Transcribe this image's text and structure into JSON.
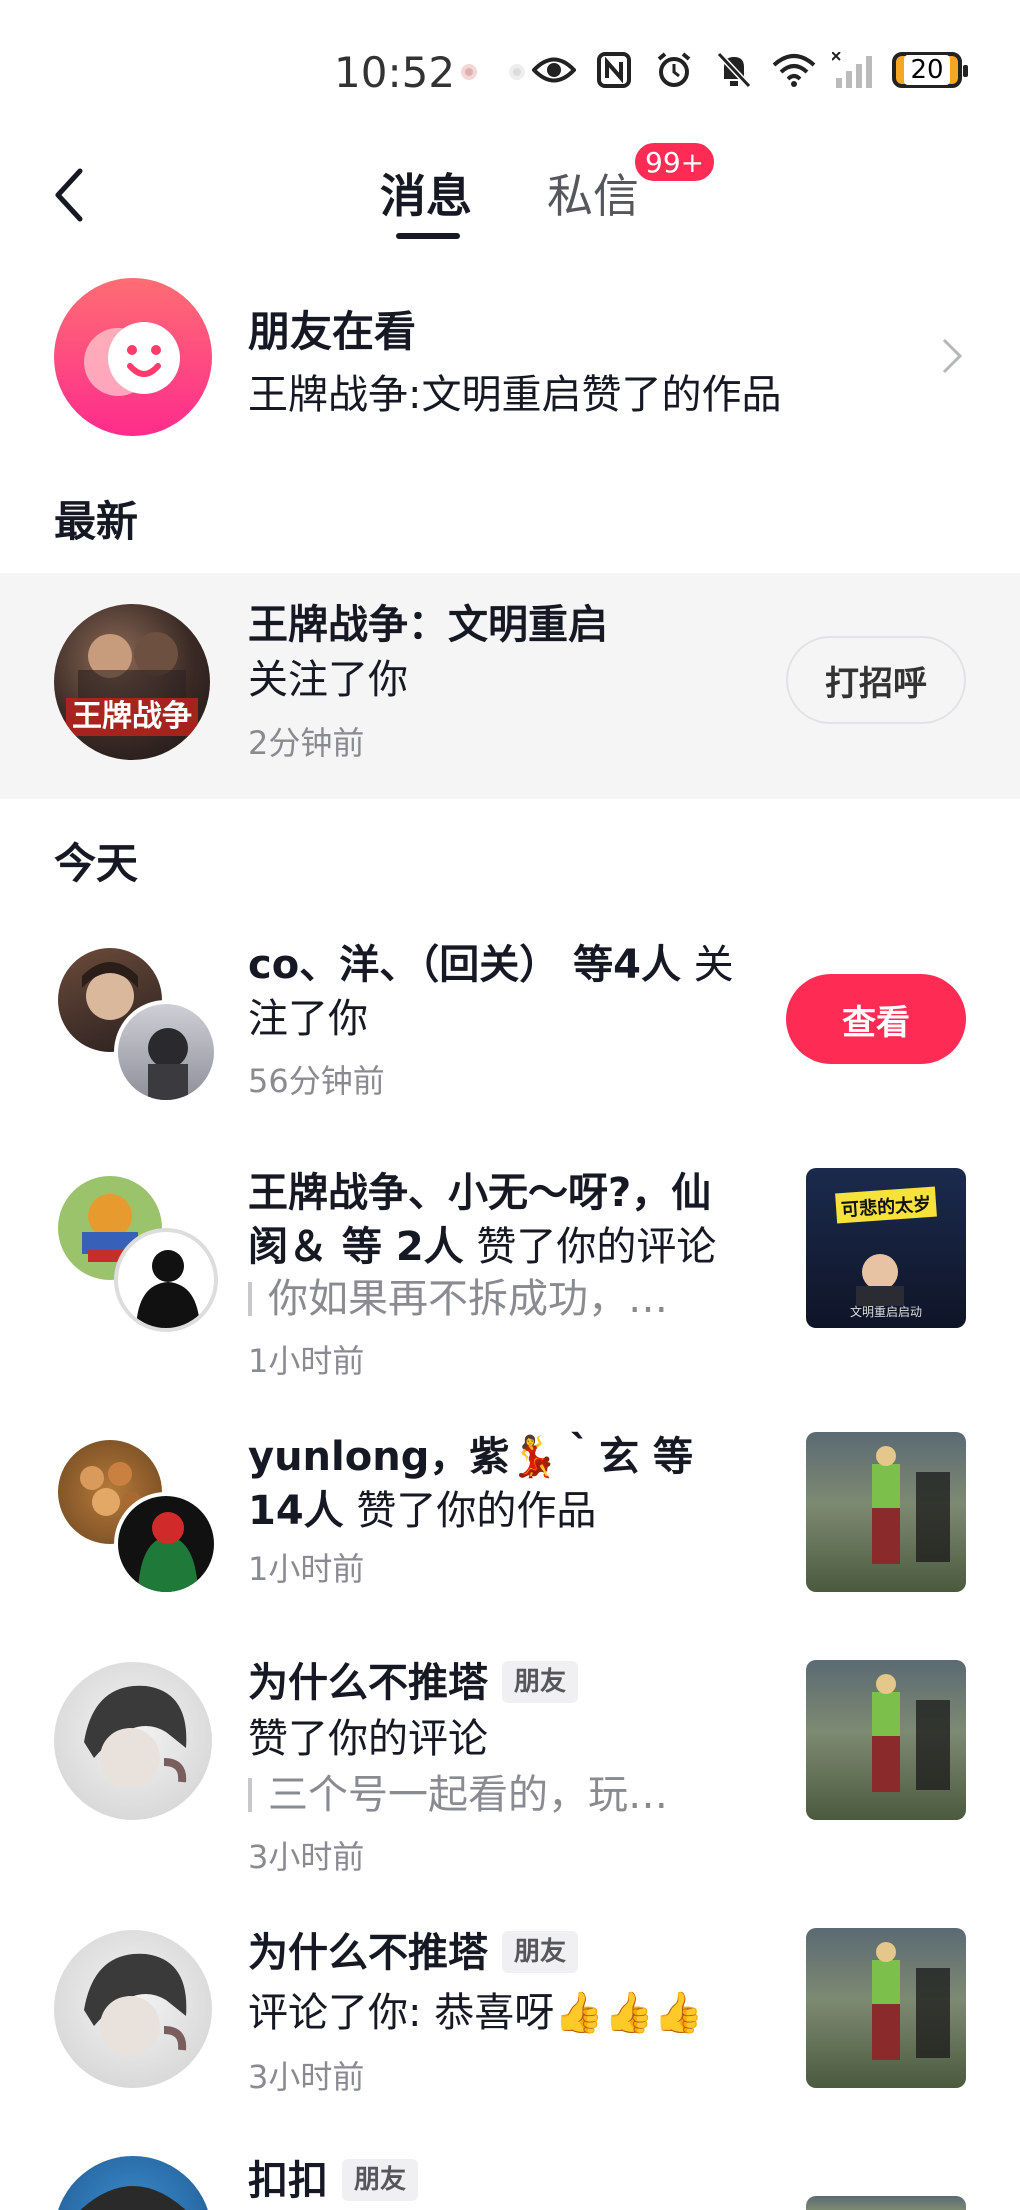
{
  "status_bar": {
    "time": "10:52",
    "battery": "20",
    "icons": [
      "eye-icon",
      "nfc-icon",
      "alarm-icon",
      "mute-icon",
      "wifi-icon",
      "signal-icon"
    ]
  },
  "header": {
    "tab_messages": "消息",
    "tab_dm": "私信",
    "dm_badge": "99+"
  },
  "friends_watching": {
    "title": "朋友在看",
    "subtitle": "王牌战争:文明重启赞了的作品"
  },
  "sections": {
    "latest": "最新",
    "today": "今天"
  },
  "latest_item": {
    "name": "王牌战争：文明重启",
    "action": "关注了你",
    "time": "2分钟前",
    "button": "打招呼",
    "avatar_text": "王牌战争"
  },
  "today_items": [
    {
      "title_bold": "co、洋、（回关） 等4人",
      "title_rest": " 关注了你",
      "time": "56分钟前",
      "button": "查看"
    },
    {
      "title_bold": "王牌战争、小无～呀?，仙阂＆ 等 2人",
      "title_rest": " 赞了你的评论",
      "quote": "你如果再不拆成功，…",
      "time": "1小时前",
      "thumb_top": "可悲的太岁",
      "thumb_bottom": "文明重启启动"
    },
    {
      "title_bold": "yunlong，紫💃｀玄 等 14人",
      "title_rest": " 赞了你的作品",
      "time": "1小时前"
    },
    {
      "title_bold": "为什么不推塔",
      "tag": "朋友",
      "action": "赞了你的评论",
      "quote": "三个号一起看的，玩…",
      "time": "3小时前"
    },
    {
      "title_bold": "为什么不推塔",
      "tag": "朋友",
      "action": "评论了你: 恭喜呀👍👍👍",
      "time": "3小时前"
    },
    {
      "title_bold": "扣扣",
      "tag": "朋友"
    }
  ]
}
